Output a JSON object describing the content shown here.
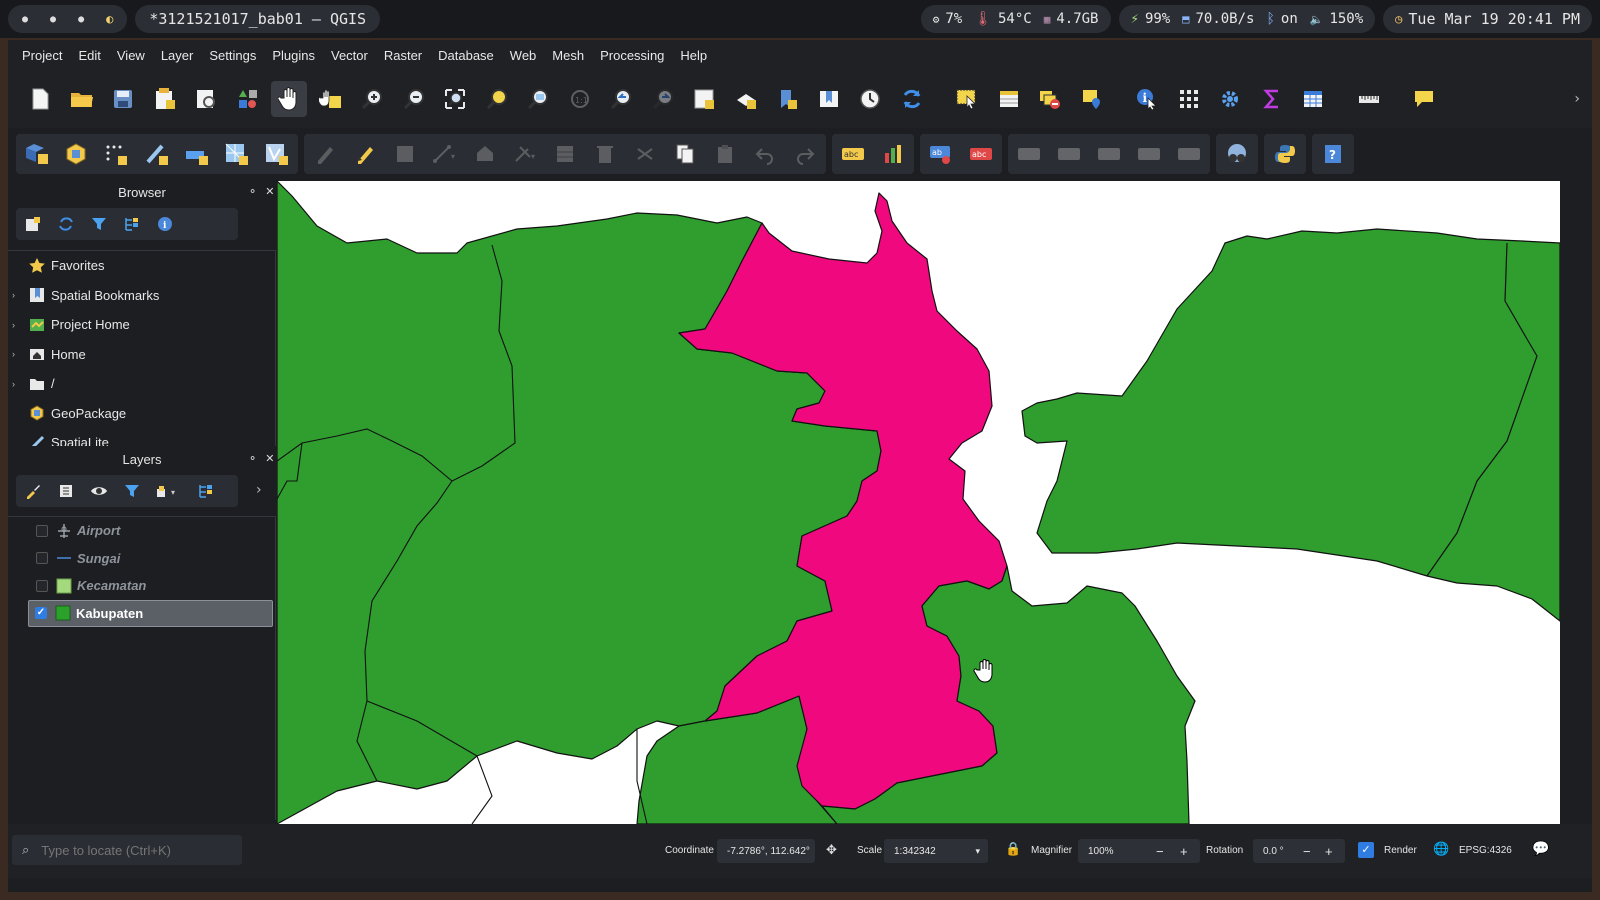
{
  "system_bar": {
    "window_title": "*3121521017_bab01 — QGIS",
    "cpu": "7%",
    "temperature": "54°C",
    "memory": "4.7GB",
    "battery": "99%",
    "network": "70.0B/s",
    "bluetooth": "on",
    "volume": "150%",
    "datetime": "Tue Mar 19 20:41 PM"
  },
  "menu": [
    "Project",
    "Edit",
    "View",
    "Layer",
    "Settings",
    "Plugins",
    "Vector",
    "Raster",
    "Database",
    "Web",
    "Mesh",
    "Processing",
    "Help"
  ],
  "browser": {
    "title": "Browser",
    "items": [
      {
        "label": "Favorites",
        "icon": "star-icon",
        "expandable": false
      },
      {
        "label": "Spatial Bookmarks",
        "icon": "bookmark-icon",
        "expandable": true
      },
      {
        "label": "Project Home",
        "icon": "project-home-icon",
        "expandable": true
      },
      {
        "label": "Home",
        "icon": "home-folder-icon",
        "expandable": true
      },
      {
        "label": "/",
        "icon": "folder-icon",
        "expandable": true
      },
      {
        "label": "GeoPackage",
        "icon": "geopackage-icon",
        "expandable": false
      },
      {
        "label": "SpatiaLite",
        "icon": "spatialite-icon",
        "expandable": false
      }
    ]
  },
  "layers": {
    "title": "Layers",
    "items": [
      {
        "label": "Airport",
        "symbol": "airport-icon",
        "checked": false,
        "selected": false
      },
      {
        "label": "Sungai",
        "symbol": "line-symbol-icon",
        "checked": false,
        "selected": false
      },
      {
        "label": "Kecamatan",
        "symbol": "fill-symbol-icon",
        "checked": false,
        "selected": false,
        "color": "#a5d97e"
      },
      {
        "label": "Kabupaten",
        "symbol": "fill-symbol-icon",
        "checked": true,
        "selected": true,
        "color": "#2ba02b"
      }
    ]
  },
  "map": {
    "land_color": "#2f9e2f",
    "highlight_color": "#f0087f",
    "water_color": "#ffffff"
  },
  "status": {
    "locator_placeholder": "Type to locate (Ctrl+K)",
    "coordinate_label": "Coordinate",
    "coordinate_value": "-7.2786°, 112.642°",
    "scale_label": "Scale",
    "scale_value": "1:342342",
    "magnifier_label": "Magnifier",
    "magnifier_value": "100%",
    "rotation_label": "Rotation",
    "rotation_value": "0.0 °",
    "render_label": "Render",
    "render_checked": true,
    "crs": "EPSG:4326"
  }
}
